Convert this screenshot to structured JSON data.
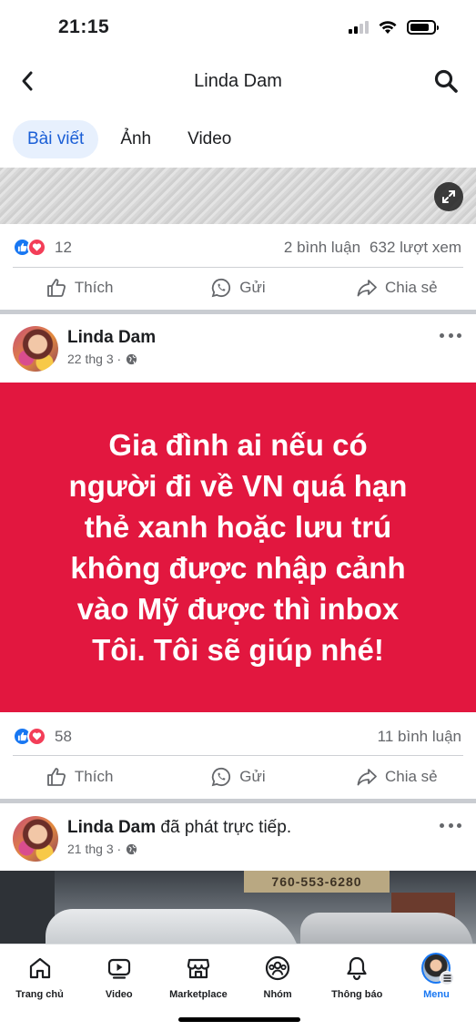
{
  "status_bar": {
    "time": "21:15"
  },
  "header": {
    "title": "Linda Dam"
  },
  "tabs": [
    {
      "label": "Bài viết",
      "active": true
    },
    {
      "label": "Ảnh",
      "active": false
    },
    {
      "label": "Video",
      "active": false
    }
  ],
  "post1": {
    "reaction_count": "12",
    "comments": "2 bình luận",
    "views": "632 lượt xem",
    "actions": {
      "like": "Thích",
      "send": "Gửi",
      "share": "Chia sẻ"
    }
  },
  "post2": {
    "author": "Linda Dam",
    "date": "22 thg 3 ·",
    "text": "Gia đình ai nếu có người đi về VN quá hạn thẻ xanh hoặc lưu trú không được nhập cảnh vào Mỹ được thì inbox Tôi. Tôi sẽ giúp nhé!",
    "text_lines": [
      "Gia đình ai nếu có",
      "người đi về VN quá hạn",
      "thẻ xanh hoặc lưu trú",
      "không được nhập cảnh",
      "vào Mỹ được thì inbox",
      "Tôi. Tôi sẽ giúp nhé!"
    ],
    "background_color": "#e2173f",
    "reaction_count": "58",
    "comments": "11 bình luận",
    "actions": {
      "like": "Thích",
      "send": "Gửi",
      "share": "Chia sẻ"
    }
  },
  "post3": {
    "author": "Linda Dam",
    "author_suffix": "đã phát trực tiếp.",
    "date": "21 thg 3 ·",
    "image_sign_text": "760-553-6280"
  },
  "bottom_nav": [
    {
      "label": "Trang chủ",
      "icon": "home-icon",
      "active": false
    },
    {
      "label": "Video",
      "icon": "video-icon",
      "active": false
    },
    {
      "label": "Marketplace",
      "icon": "marketplace-icon",
      "active": false
    },
    {
      "label": "Nhóm",
      "icon": "groups-icon",
      "active": false
    },
    {
      "label": "Thông báo",
      "icon": "bell-icon",
      "active": false
    },
    {
      "label": "Menu",
      "icon": "menu-avatar",
      "active": true
    }
  ],
  "colors": {
    "accent": "#1877f2",
    "tab_active_bg": "#e7f0fd",
    "text_secondary": "#65676b",
    "like": "#1877f2",
    "love": "#f33e58"
  }
}
